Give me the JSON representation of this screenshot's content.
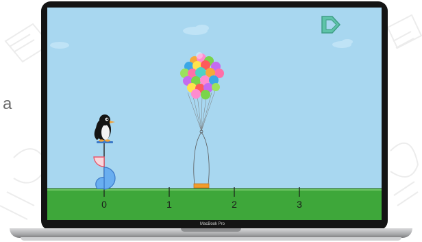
{
  "side_text": "a",
  "laptop": {
    "model_label": "MacBook Pro"
  },
  "colors": {
    "sky": "#a8d7f0",
    "ground": "#3ea73a",
    "ground_dark": "#2f8e2c",
    "next_button": "#5ec3a8",
    "counterweight_red": "#e9566b",
    "counterweight_blue": "#69aef0",
    "basket": "#f29c2b"
  },
  "game": {
    "number_line": {
      "ticks": [
        "0",
        "1",
        "2",
        "3"
      ]
    },
    "next_button_icon": "next-arrow-icon",
    "balloons": {
      "colors": [
        "#ff6fa8",
        "#7ad44a",
        "#3ba7e6",
        "#f6a93b",
        "#c56bf0",
        "#ffe34d",
        "#ff5a5a",
        "#4fd1c5",
        "#ff8ccf",
        "#9be15d"
      ]
    }
  }
}
